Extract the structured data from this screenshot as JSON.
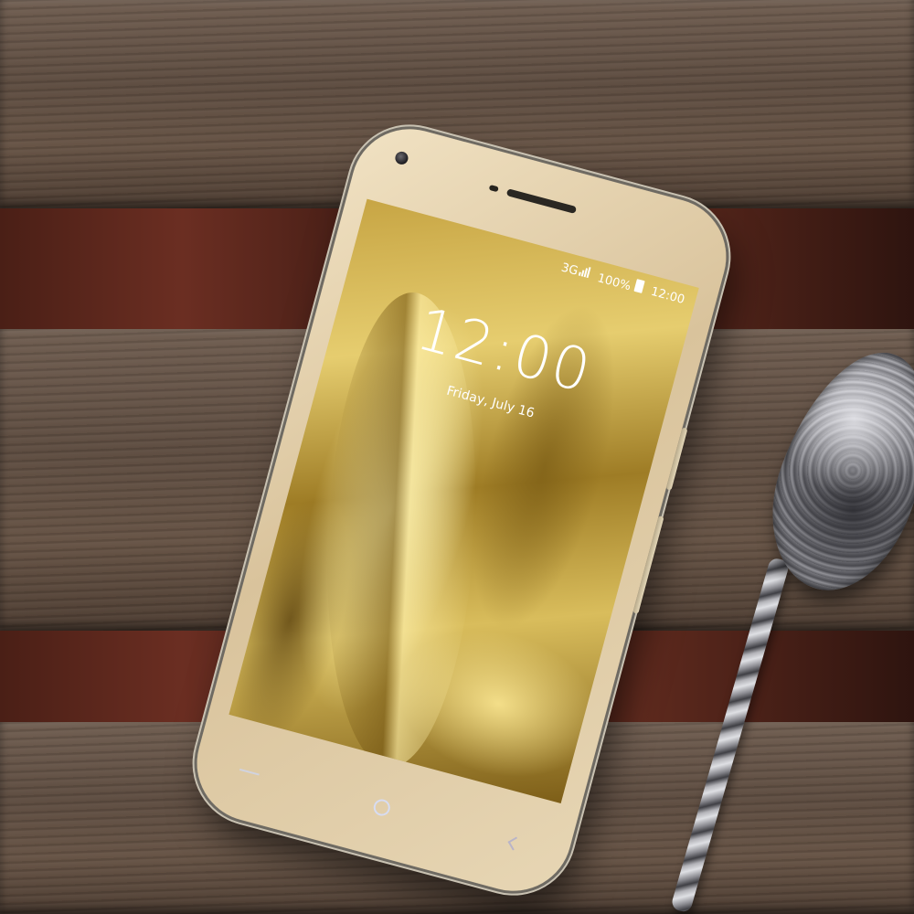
{
  "lock_screen": {
    "time": "12:00",
    "date": "Friday, July 16"
  },
  "status_bar": {
    "network": "3G",
    "battery": "100%",
    "clock": "12:00"
  },
  "colors": {
    "phone_body": "#e3d2ae",
    "screen_gold": "#d4b552",
    "wood": "#5e4d41",
    "brick": "#6b2e22"
  }
}
